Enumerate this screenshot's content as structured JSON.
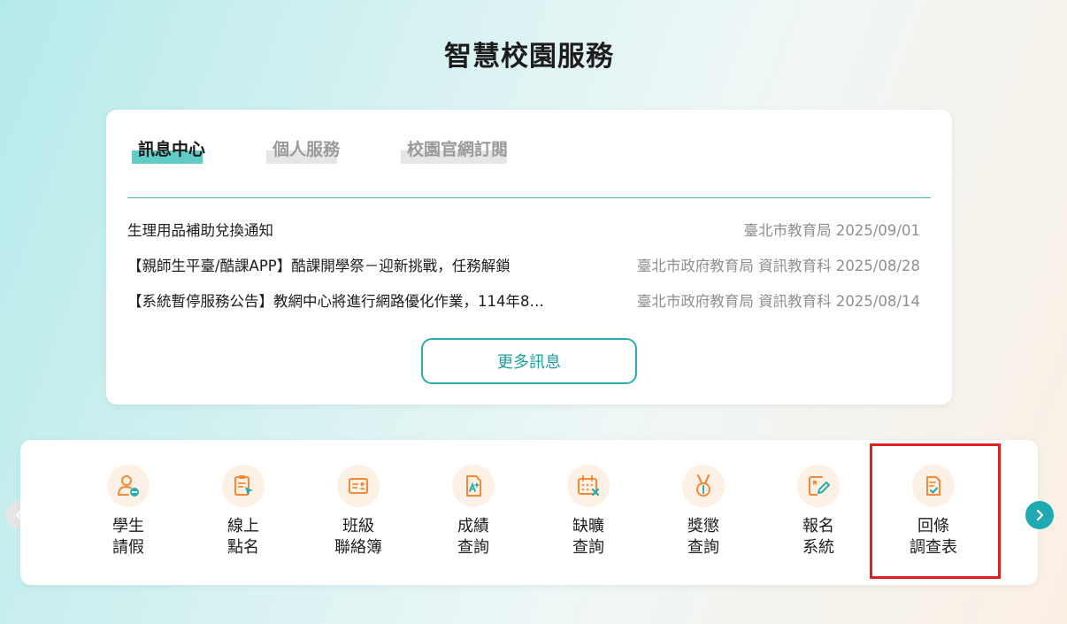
{
  "page": {
    "title": "智慧校園服務"
  },
  "news": {
    "tabs": [
      {
        "label": "訊息中心"
      },
      {
        "label": "個人服務"
      },
      {
        "label": "校園官網訂閱"
      }
    ],
    "items": [
      {
        "title": "生理用品補助兌換通知",
        "meta": "臺北市教育局 2025/09/01"
      },
      {
        "title": "【親師生平臺/酷課APP】酷課開學祭－迎新挑戰，任務解鎖",
        "meta": "臺北市政府教育局 資訊教育科 2025/08/28"
      },
      {
        "title": "【系統暫停服務公告】教網中心將進行網路優化作業，114年8…",
        "meta": "臺北市政府教育局 資訊教育科 2025/08/14"
      }
    ],
    "more_label": "更多訊息"
  },
  "services": [
    {
      "line1": "學生",
      "line2": "請假",
      "icon": "student-leave-icon"
    },
    {
      "line1": "線上",
      "line2": "點名",
      "icon": "online-rollcall-icon"
    },
    {
      "line1": "班級",
      "line2": "聯絡簿",
      "icon": "class-contact-book-icon"
    },
    {
      "line1": "成績",
      "line2": "查詢",
      "icon": "grade-query-icon"
    },
    {
      "line1": "缺曠",
      "line2": "查詢",
      "icon": "absence-query-icon"
    },
    {
      "line1": "獎懲",
      "line2": "查詢",
      "icon": "reward-medal-icon"
    },
    {
      "line1": "報名",
      "line2": "系統",
      "icon": "registration-icon"
    },
    {
      "line1": "回條",
      "line2": "調查表",
      "icon": "survey-form-icon"
    }
  ],
  "colors": {
    "accent": "#1fa9b0",
    "icon_orange": "#f28a3a",
    "icon_bg": "#fdf0e4",
    "highlight_red": "#e02020"
  }
}
